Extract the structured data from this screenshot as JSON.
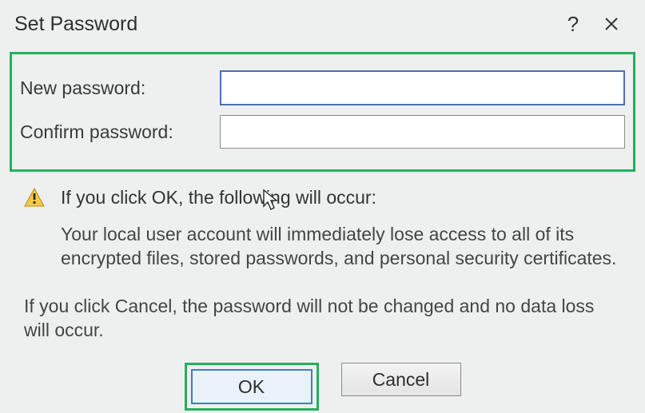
{
  "dialog": {
    "title": "Set Password",
    "help_symbol": "?",
    "new_password_label": "New password:",
    "new_password_value": "",
    "confirm_password_label": "Confirm password:",
    "confirm_password_value": "",
    "warning_heading": "If you click OK, the following will occur:",
    "warning_body": "Your local user account will immediately lose access to all of its encrypted files, stored passwords, and personal security certificates.",
    "cancel_note": "If you click Cancel, the password will not be changed and no data loss will occur.",
    "ok_label": "OK",
    "cancel_label": "Cancel"
  }
}
